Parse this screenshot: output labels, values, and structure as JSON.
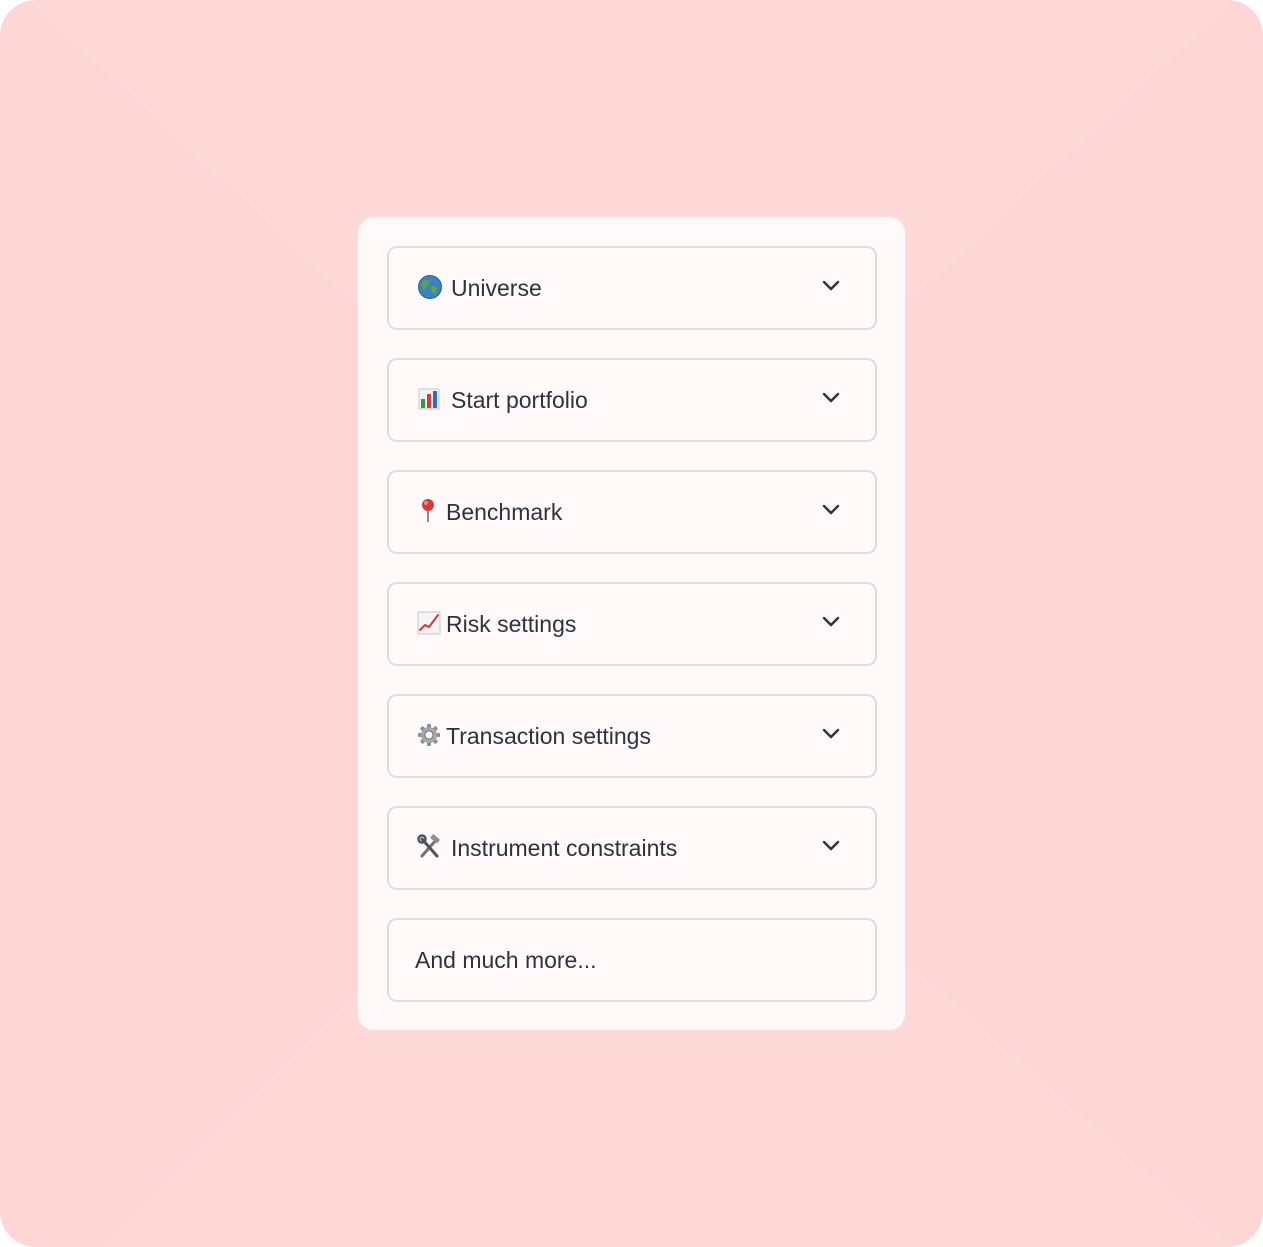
{
  "accordion": {
    "items": [
      {
        "label": "Universe",
        "icon": "globe-icon",
        "expandable": true
      },
      {
        "label": "Start portfolio",
        "icon": "bar-chart-icon",
        "expandable": true
      },
      {
        "label": "Benchmark",
        "icon": "round-pushpin-icon",
        "expandable": true
      },
      {
        "label": "Risk settings",
        "icon": "chart-increasing-icon",
        "expandable": true
      },
      {
        "label": "Transaction settings",
        "icon": "gear-icon",
        "expandable": true
      },
      {
        "label": "Instrument constraints",
        "icon": "hammer-and-wrench-icon",
        "expandable": true
      },
      {
        "label": "And much more...",
        "icon": "",
        "expandable": false
      }
    ]
  },
  "colors": {
    "background": "#fdd6d5",
    "panel": "#fffaf9",
    "item_border": "#e2dcdd",
    "text": "#2e3140"
  }
}
